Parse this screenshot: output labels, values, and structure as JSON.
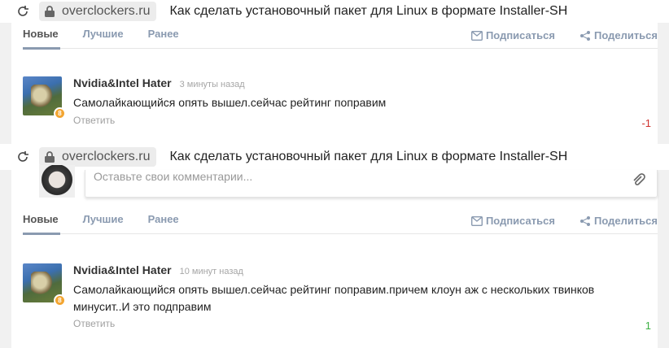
{
  "browser": {
    "host": "overclockers.ru",
    "page_title": "Как сделать установочный пакет для Linux в формате Installer-SH"
  },
  "tabs": {
    "new": "Новые",
    "best": "Лучшие",
    "earlier": "Ранее",
    "subscribe": "Подписаться",
    "share": "Поделиться"
  },
  "comment_input": {
    "placeholder": "Оставьте свои комментарии..."
  },
  "comment_first": {
    "author": "Nvidia&Intel Hater",
    "time": "3 минуты назад",
    "text": "Самолайкающийся опять вышел.сейчас рейтинг поправим",
    "reply": "Ответить",
    "score": "-1",
    "badge": "8"
  },
  "comment_second": {
    "author": "Nvidia&Intel Hater",
    "time": "10 минут назад",
    "text": "Самолайкающийся опять вышел.сейчас рейтинг поправим.причем клоун аж с нескольких твинков минусит..И это подправим",
    "reply": "Ответить",
    "score": "1",
    "badge": "8"
  },
  "colors": {
    "accent": "#8a9ab0",
    "negative": "#d0312d",
    "positive": "#3cb043",
    "badge": "#f3a531"
  },
  "icons": [
    "reload-icon",
    "lock-icon",
    "mail-icon",
    "share-icon",
    "paperclip-icon"
  ]
}
